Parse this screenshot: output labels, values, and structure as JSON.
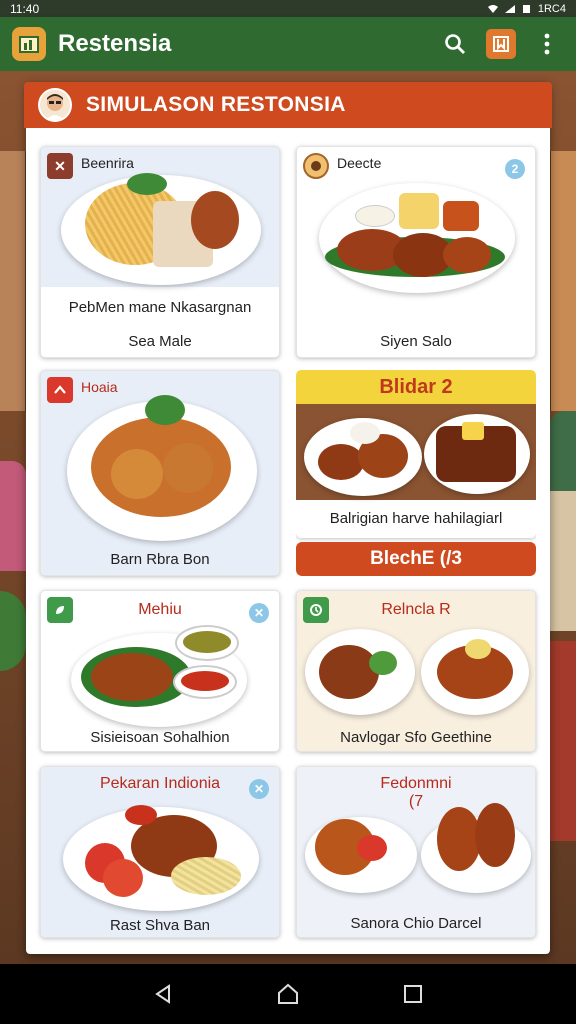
{
  "status": {
    "time": "11:40",
    "right_text": "1RC4"
  },
  "app": {
    "title": "Restensia"
  },
  "panel": {
    "title": "SIMULASON RESTONSIA"
  },
  "cards": [
    {
      "corner_label": "Beenrira",
      "caption1": "PebMen mane Nkasargnan",
      "caption2": "Sea Male"
    },
    {
      "corner_label": "Deecte",
      "badge": "2",
      "caption1": "Siyen Salo"
    },
    {
      "corner_label": "Hoaia",
      "caption1": "Barn Rbra Bon"
    },
    {
      "header": "Blidar 2",
      "caption1": "Balrigian harve hahilagiarl",
      "button": "BlechE (/3"
    },
    {
      "title": "Mehiu",
      "caption1": "Sisieisoan Sohalhion"
    },
    {
      "title": "Relncla R",
      "caption1": "Navlogar Sfo Geethine"
    },
    {
      "title": "Pekaran Indionia",
      "caption1": "Rast Shva Ban"
    },
    {
      "title": "Fedonmni",
      "subtitle": "(7",
      "caption1": "Sanora Chio Darcel"
    }
  ],
  "colors": {
    "appbar": "#2f6b30",
    "accent": "#cf4a1f",
    "yellow": "#f4d43c"
  }
}
